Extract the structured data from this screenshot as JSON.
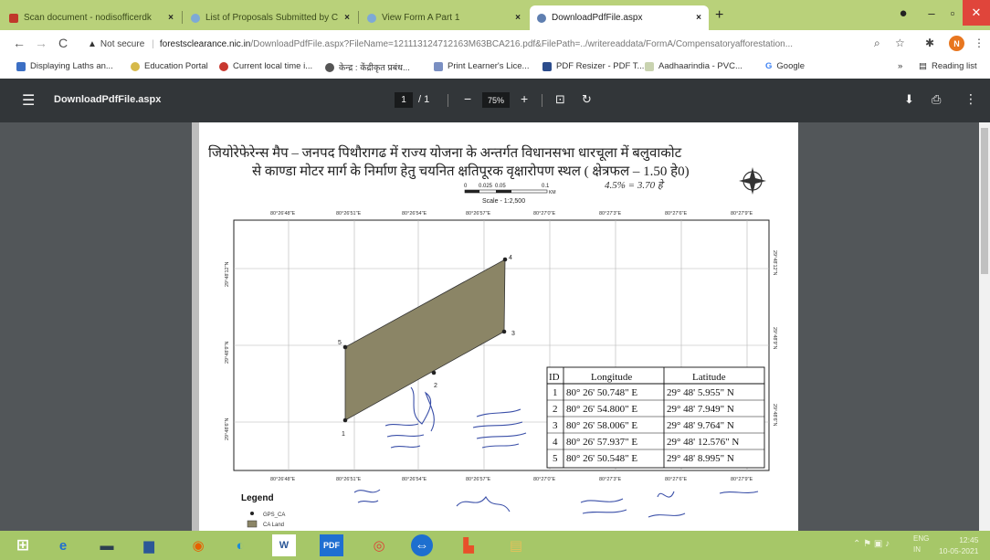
{
  "tabs": [
    {
      "title": "Scan document - nodisofficerdk"
    },
    {
      "title": "List of Proposals Submitted by C"
    },
    {
      "title": "View Form A Part 1"
    },
    {
      "title": "DownloadPdfFile.aspx"
    }
  ],
  "address": {
    "security": "Not secure",
    "host": "forestsclearance.nic.in",
    "path": "/DownloadPdfFile.aspx?FileName=121113124712163M63BCA216.pdf&FilePath=../writereaddata/FormA/Compensatoryafforestation..."
  },
  "profile_initial": "N",
  "bookmarks": [
    {
      "label": "Displaying Laths an..."
    },
    {
      "label": "Education Portal"
    },
    {
      "label": "Current local time i..."
    },
    {
      "label": "केन्द्र : केंद्रीकृत प्रबंध..."
    },
    {
      "label": "Print Learner's Lice..."
    },
    {
      "label": "PDF Resizer - PDF T..."
    },
    {
      "label": "Aadhaarindia - PVC..."
    },
    {
      "label": "Google"
    }
  ],
  "reading_list": "Reading list",
  "pdf": {
    "filename": "DownloadPdfFile.aspx",
    "current_page": "1",
    "total_pages": "/ 1",
    "zoom": "75%"
  },
  "map": {
    "title_line1": "जियोरेफेरेन्स मैप – जनपद पिथौरागढ में राज्य योजना के अन्तर्गत विधानसभा धारचूला में बलुवाकोट",
    "title_line2": "से काण्डा मोटर मार्ग के निर्माण हेतु चयनित क्षतिपूरक वृक्षारोपण स्थल ( क्षेत्रफल – 1.50 हे0)",
    "handwritten_note": "4.5% = 3.70 हे",
    "scale_label": "Scale - 1:2,500",
    "scale_ticks": [
      "0",
      "0.025",
      "0.05",
      "0.1"
    ],
    "scale_unit": "KM",
    "top_lon_labels": [
      "80°26'48\"E",
      "80°26'51\"E",
      "80°26'54\"E",
      "80°26'57\"E",
      "80°27'0\"E",
      "80°27'3\"E",
      "80°27'6\"E",
      "80°27'9\"E"
    ],
    "bottom_lon_labels": [
      "80°26'48\"E",
      "80°26'51\"E",
      "80°26'54\"E",
      "80°26'57\"E",
      "80°27'0\"E",
      "80°27'3\"E",
      "80°27'6\"E",
      "80°27'9\"E"
    ],
    "left_lat_labels": [
      "29°48'12\"N",
      "29°48'9\"N",
      "29°48'6\"N"
    ],
    "right_lat_labels": [
      "29°48'12\"N",
      "29°48'9\"N",
      "29°48'6\"N"
    ],
    "point_labels": [
      "1",
      "2",
      "3",
      "4",
      "5"
    ],
    "table_headers": [
      "ID",
      "Longitude",
      "Latitude"
    ],
    "table_rows": [
      {
        "id": "1",
        "lon": "80° 26' 50.748\" E",
        "lat": "29° 48' 5.955\" N"
      },
      {
        "id": "2",
        "lon": "80° 26' 54.800\" E",
        "lat": "29° 48' 7.949\" N"
      },
      {
        "id": "3",
        "lon": "80° 26' 58.006\" E",
        "lat": "29° 48' 9.764\" N"
      },
      {
        "id": "4",
        "lon": "80° 26' 57.937\" E",
        "lat": "29° 48' 12.576\" N"
      },
      {
        "id": "5",
        "lon": "80° 26' 50.548\" E",
        "lat": "29° 48' 8.995\" N"
      }
    ],
    "legend_title": "Legend",
    "legend_items": [
      "GPS_CA",
      "CA Land"
    ],
    "polygon_color": "#8b8566"
  },
  "tray": {
    "lang": "ENG",
    "region": "IN",
    "time": "12:45",
    "date": "10-05-2021"
  }
}
